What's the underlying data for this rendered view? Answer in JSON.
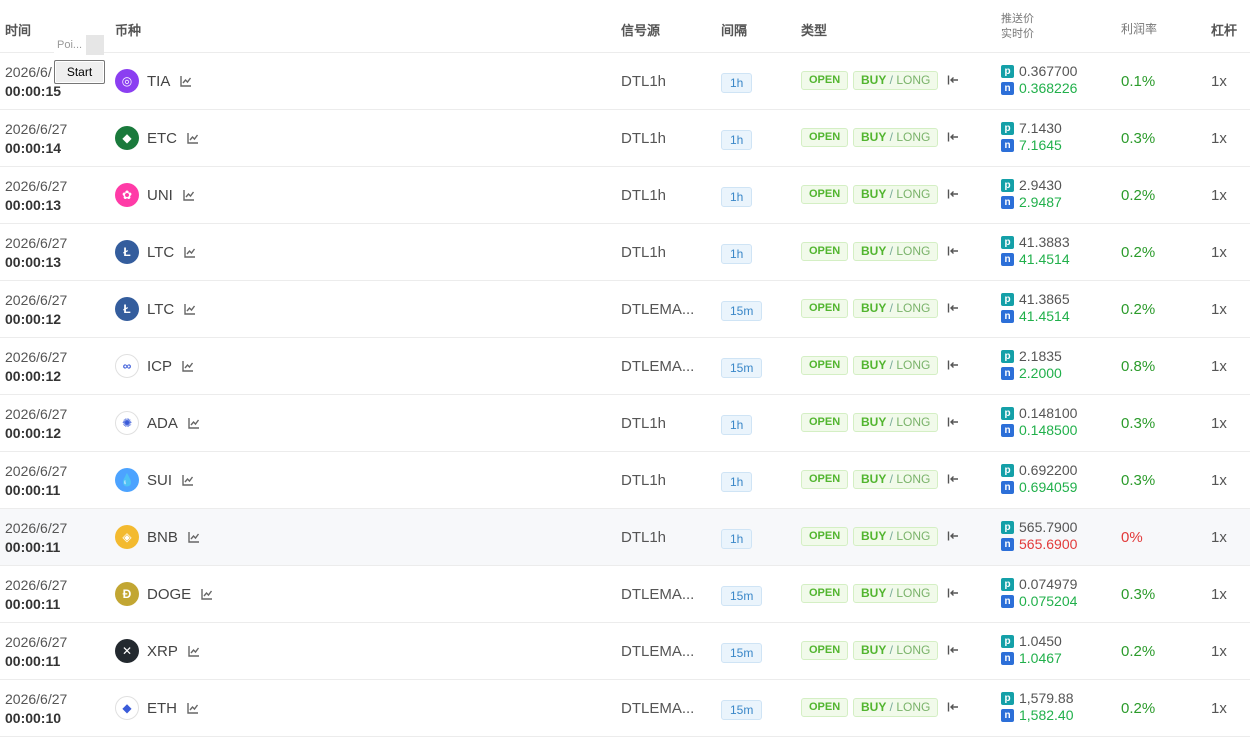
{
  "header": {
    "time": "时间",
    "coin": "币种",
    "source": "信号源",
    "interval": "间隔",
    "type": "类型",
    "push_price": "推送价",
    "real_price": "实时价",
    "profit": "利润率",
    "leverage": "杠杆"
  },
  "overlay": {
    "input_text": "Poi...",
    "start_label": "Start"
  },
  "rows": [
    {
      "date": "2026/6/",
      "time": "00:00:15",
      "coin": "TIA",
      "icon": "tia-icon",
      "color": "#8b3ff1",
      "glyph": "◎",
      "source": "DTL1h",
      "interval": "1h",
      "open": "OPEN",
      "buy": "BUY",
      "long": "LONG",
      "push": "0.367700",
      "real": "0.368226",
      "profit": "0.1%",
      "lev": "1x",
      "tag_p": "p",
      "tag_n": "n"
    },
    {
      "date": "2026/6/27",
      "time": "00:00:14",
      "coin": "ETC",
      "icon": "etc-icon",
      "color": "#1a7a3c",
      "glyph": "◆",
      "source": "DTL1h",
      "interval": "1h",
      "open": "OPEN",
      "buy": "BUY",
      "long": "LONG",
      "push": "7.1430",
      "real": "7.1645",
      "profit": "0.3%",
      "lev": "1x",
      "tag_p": "p",
      "tag_n": "n"
    },
    {
      "date": "2026/6/27",
      "time": "00:00:13",
      "coin": "UNI",
      "icon": "uni-icon",
      "color": "#ff3ba7",
      "glyph": "✿",
      "source": "DTL1h",
      "interval": "1h",
      "open": "OPEN",
      "buy": "BUY",
      "long": "LONG",
      "push": "2.9430",
      "real": "2.9487",
      "profit": "0.2%",
      "lev": "1x",
      "tag_p": "p",
      "tag_n": "n"
    },
    {
      "date": "2026/6/27",
      "time": "00:00:13",
      "coin": "LTC",
      "icon": "ltc-icon",
      "color": "#345d9d",
      "glyph": "Ł",
      "source": "DTL1h",
      "interval": "1h",
      "open": "OPEN",
      "buy": "BUY",
      "long": "LONG",
      "push": "41.3883",
      "real": "41.4514",
      "profit": "0.2%",
      "lev": "1x",
      "tag_p": "p",
      "tag_n": "n"
    },
    {
      "date": "2026/6/27",
      "time": "00:00:12",
      "coin": "LTC",
      "icon": "ltc-icon",
      "color": "#345d9d",
      "glyph": "Ł",
      "source": "DTLEMA...",
      "interval": "15m",
      "open": "OPEN",
      "buy": "BUY",
      "long": "LONG",
      "push": "41.3865",
      "real": "41.4514",
      "profit": "0.2%",
      "lev": "1x",
      "tag_p": "p",
      "tag_n": "n"
    },
    {
      "date": "2026/6/27",
      "time": "00:00:12",
      "coin": "ICP",
      "icon": "icp-icon",
      "color": "#ffffff",
      "glyph": "∞",
      "source": "DTLEMA...",
      "interval": "15m",
      "open": "OPEN",
      "buy": "BUY",
      "long": "LONG",
      "push": "2.1835",
      "real": "2.2000",
      "profit": "0.8%",
      "lev": "1x",
      "tag_p": "p",
      "tag_n": "n"
    },
    {
      "date": "2026/6/27",
      "time": "00:00:12",
      "coin": "ADA",
      "icon": "ada-icon",
      "color": "#ffffff",
      "glyph": "✺",
      "source": "DTL1h",
      "interval": "1h",
      "open": "OPEN",
      "buy": "BUY",
      "long": "LONG",
      "push": "0.148100",
      "real": "0.148500",
      "profit": "0.3%",
      "lev": "1x",
      "tag_p": "p",
      "tag_n": "n"
    },
    {
      "date": "2026/6/27",
      "time": "00:00:11",
      "coin": "SUI",
      "icon": "sui-icon",
      "color": "#4ca3ff",
      "glyph": "💧",
      "source": "DTL1h",
      "interval": "1h",
      "open": "OPEN",
      "buy": "BUY",
      "long": "LONG",
      "push": "0.692200",
      "real": "0.694059",
      "profit": "0.3%",
      "lev": "1x",
      "tag_p": "p",
      "tag_n": "n"
    },
    {
      "date": "2026/6/27",
      "time": "00:00:11",
      "coin": "BNB",
      "icon": "bnb-icon",
      "color": "#f3ba2f",
      "glyph": "◈",
      "source": "DTL1h",
      "interval": "1h",
      "open": "OPEN",
      "buy": "BUY",
      "long": "LONG",
      "push": "565.7900",
      "real": "565.6900",
      "profit": "0%",
      "lev": "1x",
      "tag_p": "p",
      "tag_n": "n",
      "down": true,
      "highlight": true
    },
    {
      "date": "2026/6/27",
      "time": "00:00:11",
      "coin": "DOGE",
      "icon": "doge-icon",
      "color": "#c2a633",
      "glyph": "Ð",
      "source": "DTLEMA...",
      "interval": "15m",
      "open": "OPEN",
      "buy": "BUY",
      "long": "LONG",
      "push": "0.074979",
      "real": "0.075204",
      "profit": "0.3%",
      "lev": "1x",
      "tag_p": "p",
      "tag_n": "n"
    },
    {
      "date": "2026/6/27",
      "time": "00:00:11",
      "coin": "XRP",
      "icon": "xrp-icon",
      "color": "#23292f",
      "glyph": "✕",
      "source": "DTLEMA...",
      "interval": "15m",
      "open": "OPEN",
      "buy": "BUY",
      "long": "LONG",
      "push": "1.0450",
      "real": "1.0467",
      "profit": "0.2%",
      "lev": "1x",
      "tag_p": "p",
      "tag_n": "n"
    },
    {
      "date": "2026/6/27",
      "time": "00:00:10",
      "coin": "ETH",
      "icon": "eth-icon",
      "color": "#ffffff",
      "glyph": "◆",
      "source": "DTLEMA...",
      "interval": "15m",
      "open": "OPEN",
      "buy": "BUY",
      "long": "LONG",
      "push": "1,579.88",
      "real": "1,582.40",
      "profit": "0.2%",
      "lev": "1x",
      "tag_p": "p",
      "tag_n": "n"
    }
  ]
}
